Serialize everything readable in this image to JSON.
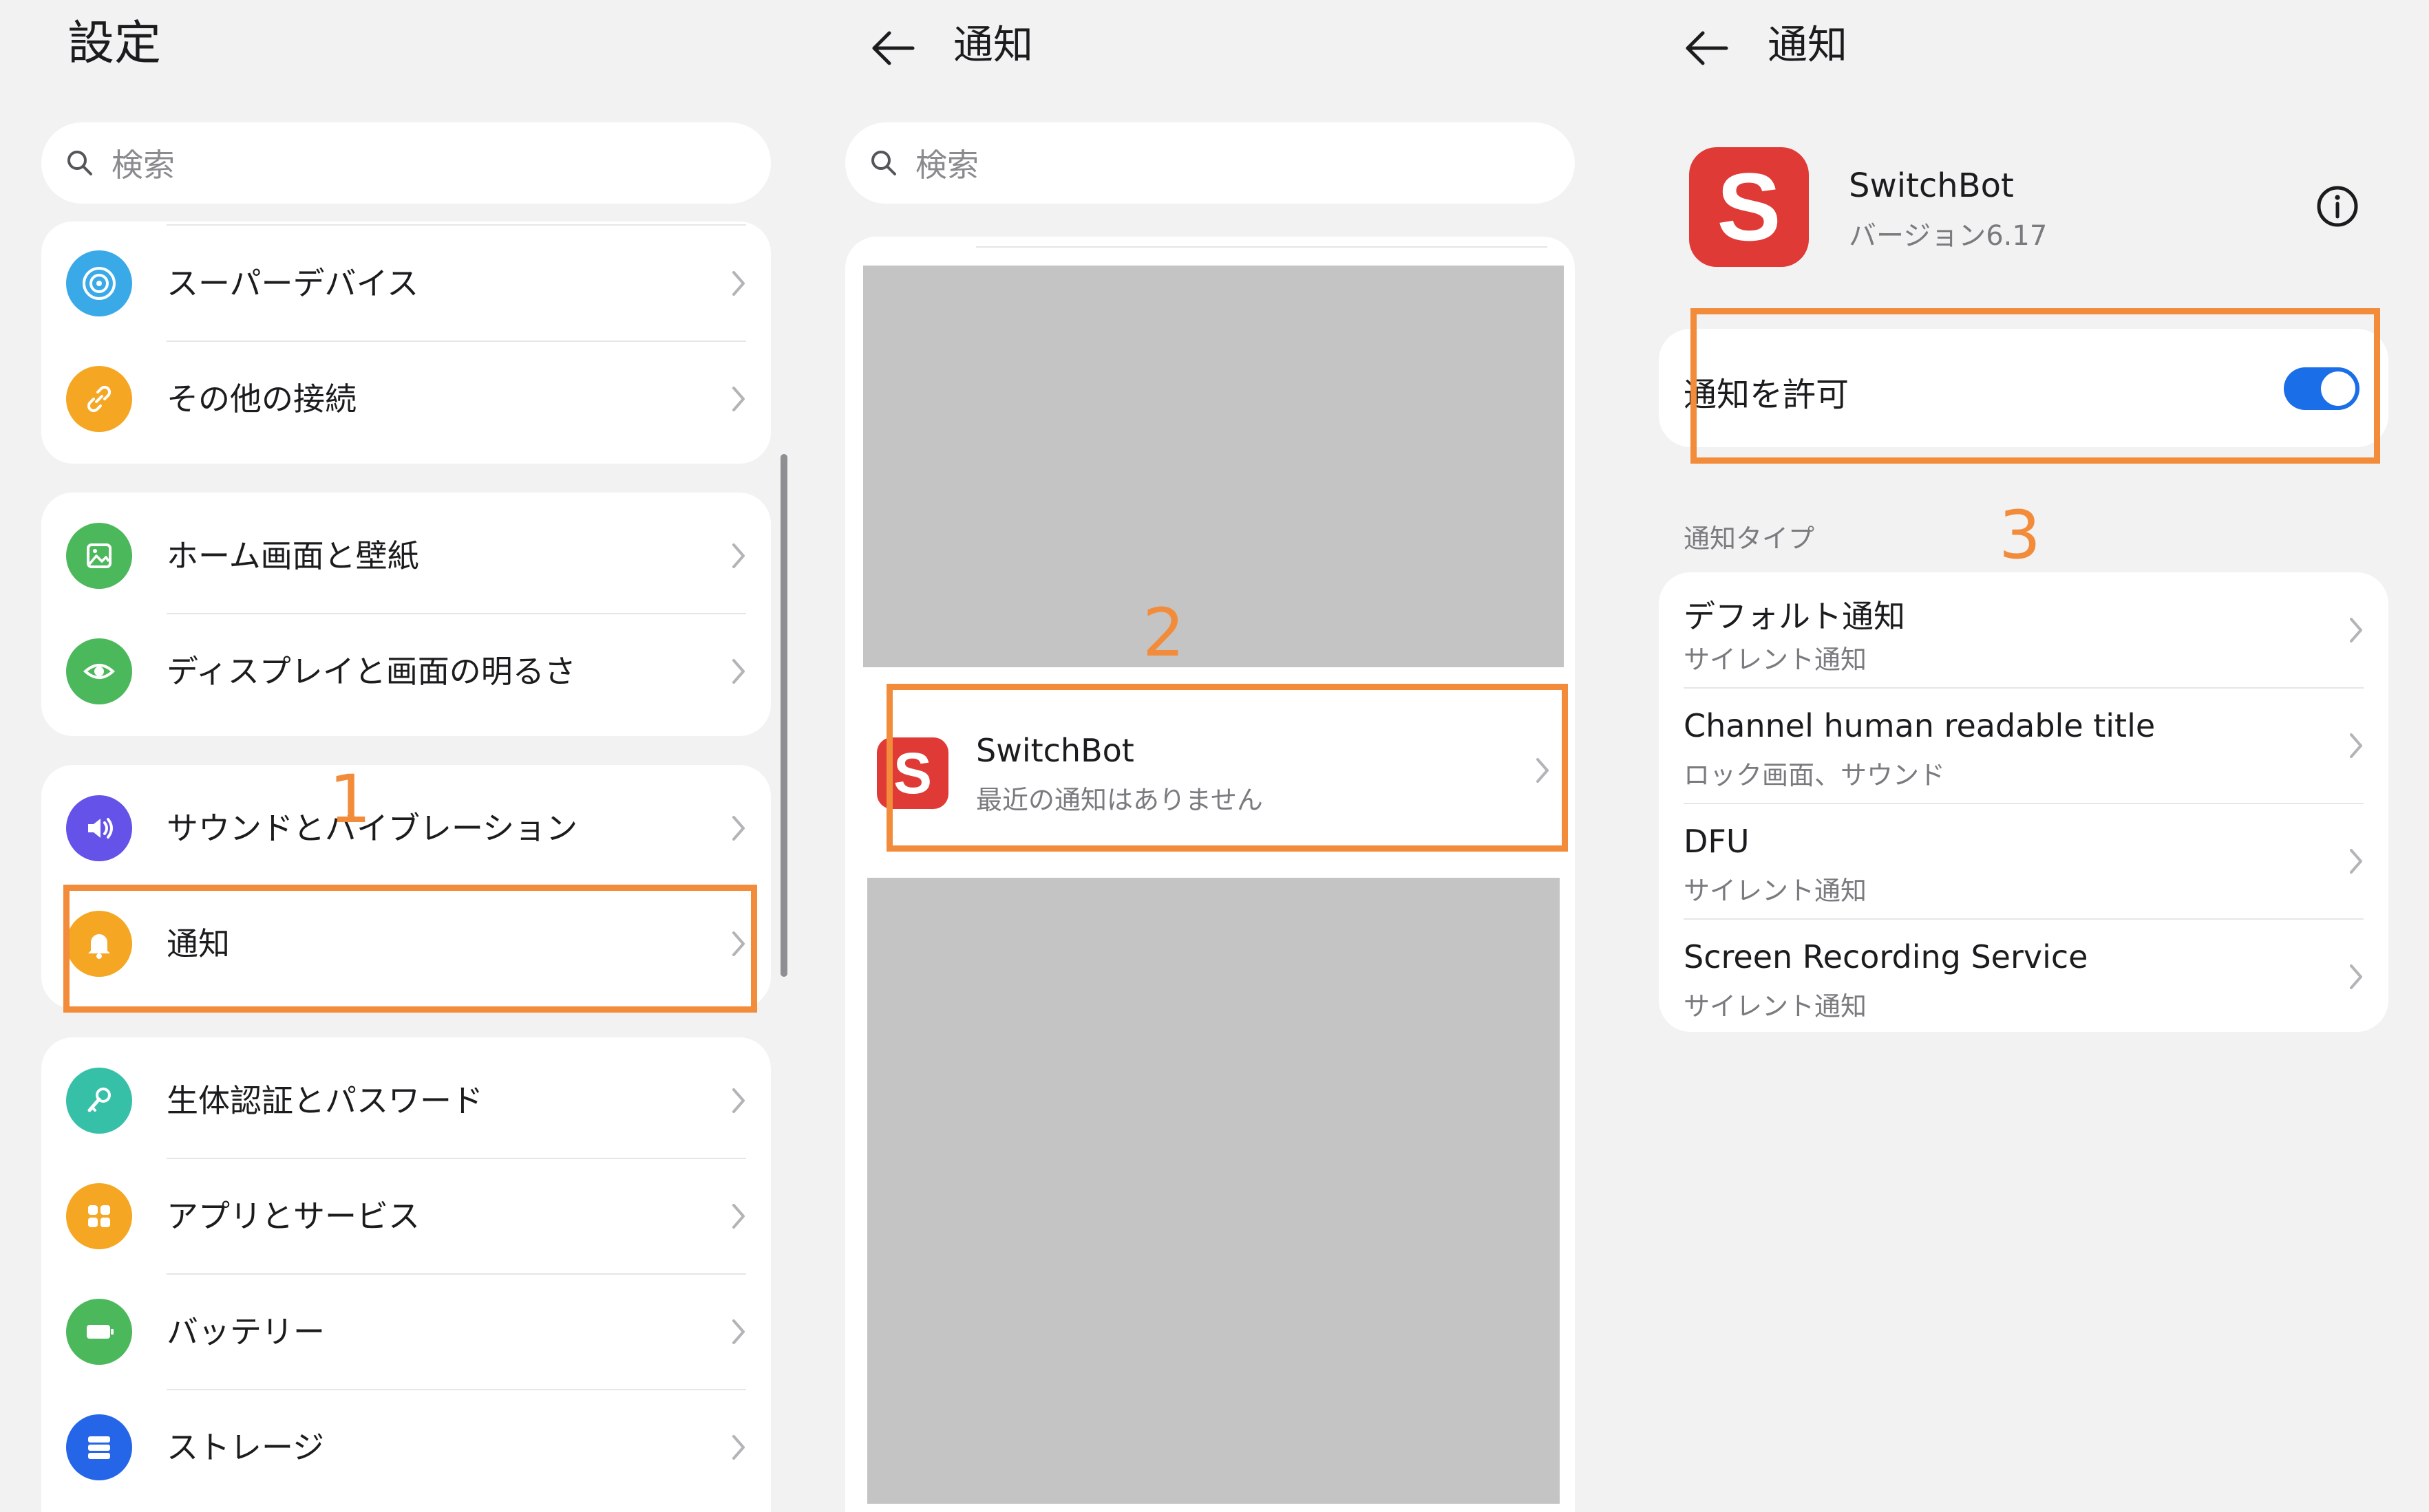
{
  "panel1": {
    "title": "設定",
    "search_placeholder": "検索",
    "groups": [
      [
        {
          "label": "スーパーデバイス",
          "icon": "super-device-icon",
          "color": "#3aa9e8"
        },
        {
          "label": "その他の接続",
          "icon": "link-icon",
          "color": "#f5a623"
        }
      ],
      [
        {
          "label": "ホーム画面と壁紙",
          "icon": "wallpaper-icon",
          "color": "#4cb85c"
        },
        {
          "label": "ディスプレイと画面の明るさ",
          "icon": "eye-icon",
          "color": "#4cb85c"
        }
      ],
      [
        {
          "label": "サウンドとバイブレーション",
          "icon": "speaker-icon",
          "color": "#6552e8"
        },
        {
          "label": "通知",
          "icon": "bell-icon",
          "color": "#f5a623"
        }
      ],
      [
        {
          "label": "生体認証とパスワード",
          "icon": "key-icon",
          "color": "#36c0a8"
        },
        {
          "label": "アプリとサービス",
          "icon": "apps-icon",
          "color": "#f5a623"
        },
        {
          "label": "バッテリー",
          "icon": "battery-icon",
          "color": "#4cb85c"
        },
        {
          "label": "ストレージ",
          "icon": "storage-icon",
          "color": "#2566e8"
        }
      ]
    ],
    "step": "1"
  },
  "panel2": {
    "title": "通知",
    "search_placeholder": "検索",
    "app": {
      "name": "SwitchBot",
      "subtitle": "最近の通知はありません"
    },
    "step": "2"
  },
  "panel3": {
    "title": "通知",
    "app": {
      "name": "SwitchBot",
      "version": "バージョン6.17"
    },
    "allow_label": "通知を許可",
    "allow_on": true,
    "section_label": "通知タイプ",
    "types": [
      {
        "title": "デフォルト通知",
        "subtitle": "サイレント通知"
      },
      {
        "title": "Channel human readable title",
        "subtitle": "ロック画面、サウンド"
      },
      {
        "title": "DFU",
        "subtitle": "サイレント通知"
      },
      {
        "title": "Screen Recording Service",
        "subtitle": "サイレント通知"
      }
    ],
    "step": "3"
  },
  "colors": {
    "accent": "#f28c3a",
    "toggle": "#1a6ee8",
    "brand_red": "#e03a36"
  }
}
